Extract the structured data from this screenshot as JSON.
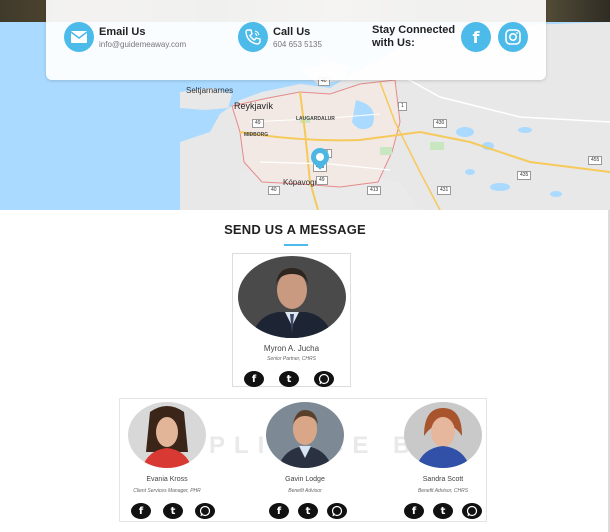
{
  "contact": {
    "email_title": "Email Us",
    "email_value": "info@guidemeaway.com",
    "call_title": "Call Us",
    "call_value": "604 653 5135",
    "stay_line1": "Stay Connected",
    "stay_line2": "with Us:"
  },
  "map": {
    "labels": {
      "reykjavik": "Reykjavík",
      "seltjarnarnes": "Seltjarnarnes",
      "laugardalur": "LAUGARDALUR",
      "midborg": "MIÐBORG",
      "kopavogur": "Kópavogur"
    },
    "roads": [
      "40",
      "49",
      "41",
      "1",
      "430",
      "413",
      "49",
      "40",
      "413",
      "431",
      "435",
      "455"
    ]
  },
  "section": {
    "title": "SEND US A MESSAGE"
  },
  "featured": {
    "name": "Myron A. Jucha",
    "role": "Senior Partner, CHRS"
  },
  "team": [
    {
      "name": "Evania Kross",
      "role": "Client Services Manager, PHR"
    },
    {
      "name": "Gavin Lodge",
      "role": "Benefit Advisor"
    },
    {
      "name": "Sandra Scott",
      "role": "Benefit Advisor, CHRS"
    }
  ],
  "watermark": "MPLIANCE B",
  "social_glyphs": {
    "facebook": "f",
    "tumblr": "t"
  },
  "colors": {
    "accent": "#4dbbe9",
    "map_water": "#aadaff",
    "map_land": "#e8e8e8"
  },
  "icons": {
    "email": "envelope-icon",
    "call": "phone-icon",
    "facebook": "facebook-icon",
    "instagram": "instagram-icon",
    "whatsapp": "whatsapp-icon",
    "pin": "map-pin-icon"
  }
}
